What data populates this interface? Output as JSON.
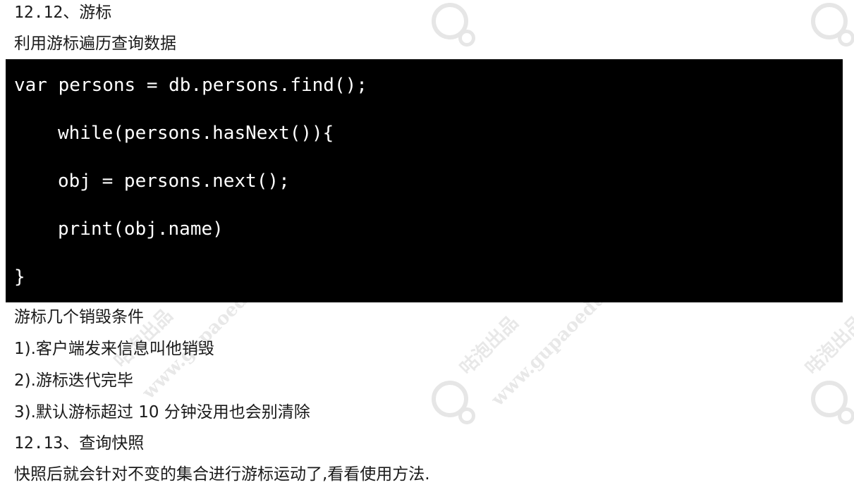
{
  "heading_1": "12.12、游标",
  "intro": "利用游标遍历查询数据",
  "code": {
    "line1": "var persons = db.persons.find();",
    "line2": "while(persons.hasNext()){",
    "line3": "obj = persons.next();",
    "line4": "print(obj.name)",
    "line5": "}"
  },
  "conditions_title": "游标几个销毁条件",
  "conditions": [
    "1).客户端发来信息叫他销毁",
    "2).游标迭代完毕",
    "3).默认游标超过 10 分钟没用也会别清除"
  ],
  "heading_2": "12.13、查询快照",
  "snapshot_text": "快照后就会针对不变的集合进行游标运动了,看看使用方法.",
  "watermark": {
    "text_cn": "咕泡出品",
    "text_url": "www.gupaoedu"
  }
}
